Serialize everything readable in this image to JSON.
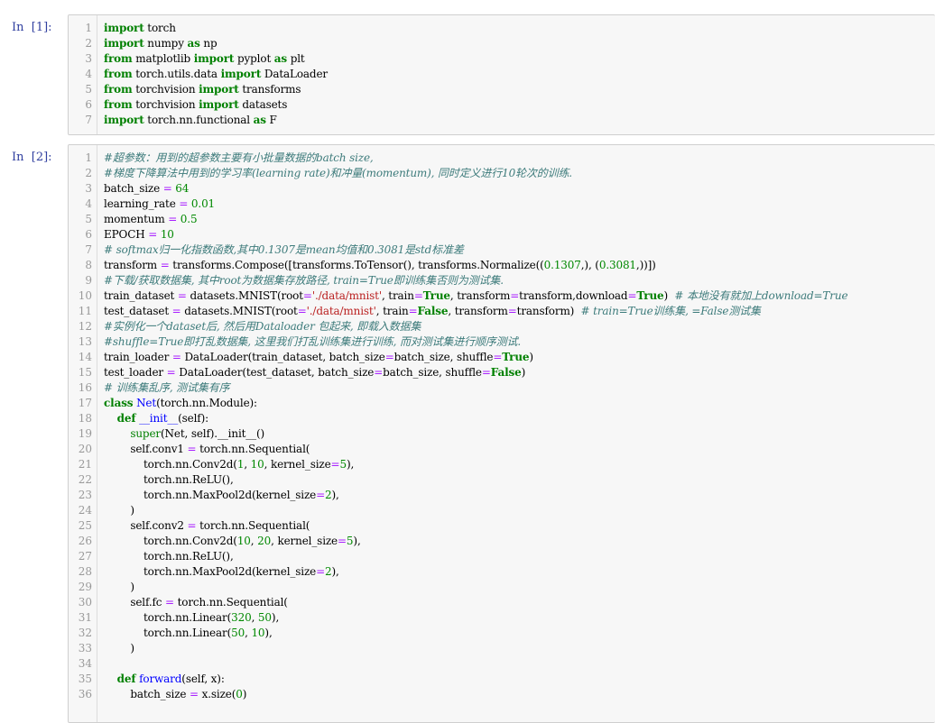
{
  "cells": [
    {
      "prompt": "In  [1]:",
      "lines": [
        [
          [
            "k",
            "import"
          ],
          [
            "p",
            " torch"
          ]
        ],
        [
          [
            "k",
            "import"
          ],
          [
            "p",
            " numpy "
          ],
          [
            "k",
            "as"
          ],
          [
            "p",
            " np"
          ]
        ],
        [
          [
            "k",
            "from"
          ],
          [
            "p",
            " matplotlib "
          ],
          [
            "k",
            "import"
          ],
          [
            "p",
            " pyplot "
          ],
          [
            "k",
            "as"
          ],
          [
            "p",
            " plt"
          ]
        ],
        [
          [
            "k",
            "from"
          ],
          [
            "p",
            " torch.utils.data "
          ],
          [
            "k",
            "import"
          ],
          [
            "p",
            " DataLoader"
          ]
        ],
        [
          [
            "k",
            "from"
          ],
          [
            "p",
            " torchvision "
          ],
          [
            "k",
            "import"
          ],
          [
            "p",
            " transforms"
          ]
        ],
        [
          [
            "k",
            "from"
          ],
          [
            "p",
            " torchvision "
          ],
          [
            "k",
            "import"
          ],
          [
            "p",
            " datasets"
          ]
        ],
        [
          [
            "k",
            "import"
          ],
          [
            "p",
            " torch.nn.functional "
          ],
          [
            "k",
            "as"
          ],
          [
            "p",
            " F"
          ]
        ]
      ]
    },
    {
      "prompt": "In  [2]:",
      "lines": [
        [
          [
            "c",
            "#超参数：用到的超参数主要有小批量数据的batch size,"
          ]
        ],
        [
          [
            "c",
            "#梯度下降算法中用到的学习率(learning rate)和冲量(momentum), 同时定义进行10轮次的训练."
          ]
        ],
        [
          [
            "p",
            "batch_size "
          ],
          [
            "m",
            "="
          ],
          [
            "p",
            " "
          ],
          [
            "n",
            "64"
          ]
        ],
        [
          [
            "p",
            "learning_rate "
          ],
          [
            "m",
            "="
          ],
          [
            "p",
            " "
          ],
          [
            "n",
            "0.01"
          ]
        ],
        [
          [
            "p",
            "momentum "
          ],
          [
            "m",
            "="
          ],
          [
            "p",
            " "
          ],
          [
            "n",
            "0.5"
          ]
        ],
        [
          [
            "p",
            "EPOCH "
          ],
          [
            "m",
            "="
          ],
          [
            "p",
            " "
          ],
          [
            "n",
            "10"
          ]
        ],
        [
          [
            "c",
            "# softmax归一化指数函数,其中0.1307是mean均值和0.3081是std标准差"
          ]
        ],
        [
          [
            "p",
            "transform "
          ],
          [
            "m",
            "="
          ],
          [
            "p",
            " transforms.Compose([transforms.ToTensor(), transforms.Normalize(("
          ],
          [
            "n",
            "0.1307"
          ],
          [
            "p",
            ",), ("
          ],
          [
            "n",
            "0.3081"
          ],
          [
            "p",
            ",))])"
          ]
        ],
        [
          [
            "c",
            "#下载/获取数据集, 其中root为数据集存放路径, train=True即训练集否则为测试集."
          ]
        ],
        [
          [
            "p",
            "train_dataset "
          ],
          [
            "m",
            "="
          ],
          [
            "p",
            " datasets.MNIST(root"
          ],
          [
            "m",
            "="
          ],
          [
            "s",
            "'./data/mnist'"
          ],
          [
            "p",
            ", train"
          ],
          [
            "m",
            "="
          ],
          [
            "k",
            "True"
          ],
          [
            "p",
            ", transform"
          ],
          [
            "m",
            "="
          ],
          [
            "p",
            "transform,download"
          ],
          [
            "m",
            "="
          ],
          [
            "k",
            "True"
          ],
          [
            "p",
            ")  "
          ],
          [
            "c",
            "# 本地没有就加上download=True"
          ]
        ],
        [
          [
            "p",
            "test_dataset "
          ],
          [
            "m",
            "="
          ],
          [
            "p",
            " datasets.MNIST(root"
          ],
          [
            "m",
            "="
          ],
          [
            "s",
            "'./data/mnist'"
          ],
          [
            "p",
            ", train"
          ],
          [
            "m",
            "="
          ],
          [
            "k",
            "False"
          ],
          [
            "p",
            ", transform"
          ],
          [
            "m",
            "="
          ],
          [
            "p",
            "transform)  "
          ],
          [
            "c",
            "# train=True训练集, =False测试集"
          ]
        ],
        [
          [
            "c",
            "#实例化一个dataset后, 然后用Dataloader 包起来, 即载入数据集"
          ]
        ],
        [
          [
            "c",
            "#shuffle=True即打乱数据集, 这里我们打乱训练集进行训练, 而对测试集进行顺序测试."
          ]
        ],
        [
          [
            "p",
            "train_loader "
          ],
          [
            "m",
            "="
          ],
          [
            "p",
            " DataLoader(train_dataset, batch_size"
          ],
          [
            "m",
            "="
          ],
          [
            "p",
            "batch_size, shuffle"
          ],
          [
            "m",
            "="
          ],
          [
            "k",
            "True"
          ],
          [
            "p",
            ")"
          ]
        ],
        [
          [
            "p",
            "test_loader "
          ],
          [
            "m",
            "="
          ],
          [
            "p",
            " DataLoader(test_dataset, batch_size"
          ],
          [
            "m",
            "="
          ],
          [
            "p",
            "batch_size, shuffle"
          ],
          [
            "m",
            "="
          ],
          [
            "k",
            "False"
          ],
          [
            "p",
            ")"
          ]
        ],
        [
          [
            "c",
            "# 训练集乱序, 测试集有序"
          ]
        ],
        [
          [
            "k",
            "class"
          ],
          [
            "p",
            " "
          ],
          [
            "f",
            "Net"
          ],
          [
            "p",
            "(torch.nn.Module):"
          ]
        ],
        [
          [
            "p",
            "    "
          ],
          [
            "k",
            "def"
          ],
          [
            "p",
            " "
          ],
          [
            "f",
            "__init__"
          ],
          [
            "p",
            "(self):"
          ]
        ],
        [
          [
            "p",
            "        "
          ],
          [
            "b",
            "super"
          ],
          [
            "p",
            "(Net, self)."
          ],
          [
            "p",
            "__init__"
          ],
          [
            "p",
            "()"
          ]
        ],
        [
          [
            "p",
            "        self.conv1 "
          ],
          [
            "m",
            "="
          ],
          [
            "p",
            " torch.nn.Sequential("
          ]
        ],
        [
          [
            "p",
            "            torch.nn.Conv2d("
          ],
          [
            "n",
            "1"
          ],
          [
            "p",
            ", "
          ],
          [
            "n",
            "10"
          ],
          [
            "p",
            ", kernel_size"
          ],
          [
            "m",
            "="
          ],
          [
            "n",
            "5"
          ],
          [
            "p",
            "),"
          ]
        ],
        [
          [
            "p",
            "            torch.nn.ReLU(),"
          ]
        ],
        [
          [
            "p",
            "            torch.nn.MaxPool2d(kernel_size"
          ],
          [
            "m",
            "="
          ],
          [
            "n",
            "2"
          ],
          [
            "p",
            "),"
          ]
        ],
        [
          [
            "p",
            "        )"
          ]
        ],
        [
          [
            "p",
            "        self.conv2 "
          ],
          [
            "m",
            "="
          ],
          [
            "p",
            " torch.nn.Sequential("
          ]
        ],
        [
          [
            "p",
            "            torch.nn.Conv2d("
          ],
          [
            "n",
            "10"
          ],
          [
            "p",
            ", "
          ],
          [
            "n",
            "20"
          ],
          [
            "p",
            ", kernel_size"
          ],
          [
            "m",
            "="
          ],
          [
            "n",
            "5"
          ],
          [
            "p",
            "),"
          ]
        ],
        [
          [
            "p",
            "            torch.nn.ReLU(),"
          ]
        ],
        [
          [
            "p",
            "            torch.nn.MaxPool2d(kernel_size"
          ],
          [
            "m",
            "="
          ],
          [
            "n",
            "2"
          ],
          [
            "p",
            "),"
          ]
        ],
        [
          [
            "p",
            "        )"
          ]
        ],
        [
          [
            "p",
            "        self.fc "
          ],
          [
            "m",
            "="
          ],
          [
            "p",
            " torch.nn.Sequential("
          ]
        ],
        [
          [
            "p",
            "            torch.nn.Linear("
          ],
          [
            "n",
            "320"
          ],
          [
            "p",
            ", "
          ],
          [
            "n",
            "50"
          ],
          [
            "p",
            "),"
          ]
        ],
        [
          [
            "p",
            "            torch.nn.Linear("
          ],
          [
            "n",
            "50"
          ],
          [
            "p",
            ", "
          ],
          [
            "n",
            "10"
          ],
          [
            "p",
            "),"
          ]
        ],
        [
          [
            "p",
            "        )"
          ]
        ],
        [
          [
            "p",
            ""
          ]
        ],
        [
          [
            "p",
            "    "
          ],
          [
            "k",
            "def"
          ],
          [
            "p",
            " "
          ],
          [
            "f",
            "forward"
          ],
          [
            "p",
            "(self, x):"
          ]
        ],
        [
          [
            "p",
            "        batch_size "
          ],
          [
            "m",
            "="
          ],
          [
            "p",
            " x.size("
          ],
          [
            "n",
            "0"
          ],
          [
            "p",
            ")"
          ]
        ]
      ]
    }
  ]
}
